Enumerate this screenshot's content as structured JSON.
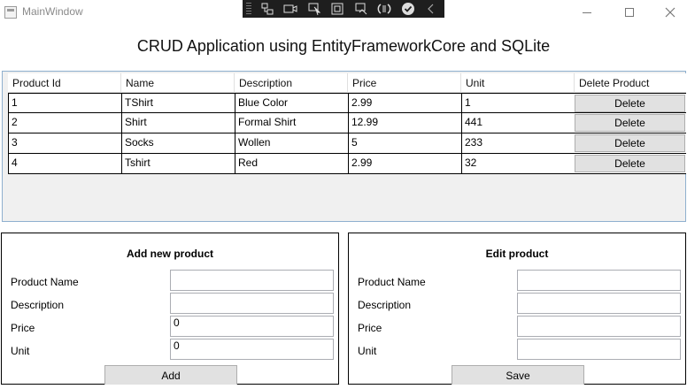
{
  "window": {
    "title": "MainWindow",
    "icon": "app-window-icon"
  },
  "debug_toolbar": {
    "icons": [
      "live-visual-tree-icon",
      "record-icon",
      "select-element-icon",
      "display-layout-adorners-icon",
      "track-focus-icon",
      "hot-reload-icon",
      "binding-check-icon",
      "collapse-chevron-icon"
    ]
  },
  "heading": "CRUD Application using EntityFrameworkCore and SQLite",
  "grid": {
    "columns": [
      "Product Id",
      "Name",
      "Description",
      "Price",
      "Unit",
      "Delete Product"
    ],
    "rows": [
      {
        "id": "1",
        "name": "TShirt",
        "description": "Blue Color",
        "price": "2.99",
        "unit": "1",
        "action": "Delete"
      },
      {
        "id": "2",
        "name": "Shirt",
        "description": "Formal Shirt",
        "price": "12.99",
        "unit": "441",
        "action": "Delete"
      },
      {
        "id": "3",
        "name": "Socks",
        "description": "Wollen",
        "price": "5",
        "unit": "233",
        "action": "Delete"
      },
      {
        "id": "4",
        "name": "Tshirt",
        "description": "Red",
        "price": "2.99",
        "unit": "32",
        "action": "Delete"
      }
    ]
  },
  "add_panel": {
    "title": "Add new product",
    "labels": {
      "name": "Product Name",
      "description": "Description",
      "price": "Price",
      "unit": "Unit"
    },
    "values": {
      "name": "",
      "description": "",
      "price": "0",
      "unit": "0"
    },
    "button": "Add"
  },
  "edit_panel": {
    "title": "Edit product",
    "labels": {
      "name": "Product Name",
      "description": "Description",
      "price": "Price",
      "unit": "Unit"
    },
    "values": {
      "name": "",
      "description": "",
      "price": "",
      "unit": ""
    },
    "button": "Save"
  }
}
